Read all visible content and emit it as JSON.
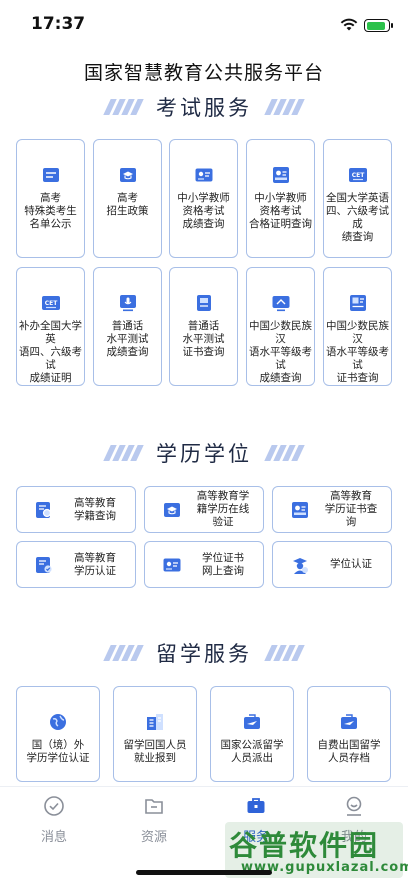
{
  "status": {
    "time": "17:37",
    "battery_level": 0.9
  },
  "page_title": "国家智慧教育公共服务平台",
  "sections": {
    "exam": {
      "title": "考试服务"
    },
    "degree": {
      "title": "学历学位"
    },
    "abroad": {
      "title": "留学服务"
    }
  },
  "exam_cards": [
    {
      "label": "高考\n特殊类考生\n名单公示",
      "icon": "list-icon"
    },
    {
      "label": "高考\n招生政策",
      "icon": "mortarboard-icon"
    },
    {
      "label": "中小学教师\n资格考试\n成绩查询",
      "icon": "id-card-icon"
    },
    {
      "label": "中小学教师\n资格考试\n合格证明查询",
      "icon": "certificate-icon"
    },
    {
      "label": "全国大学英语\n四、六级考试成\n绩查询",
      "icon": "cet-icon",
      "badge": "CET"
    },
    {
      "label": "补办全国大学英\n语四、六级考试\n成绩证明",
      "icon": "cet-icon",
      "badge": "CET"
    },
    {
      "label": "普通话\n水平测试\n成绩查询",
      "icon": "microphone-icon"
    },
    {
      "label": "普通话\n水平测试\n证书查询",
      "icon": "book-icon"
    },
    {
      "label": "中国少数民族汉\n语水平等级考试\n成绩查询",
      "icon": "monitor-icon"
    },
    {
      "label": "中国少数民族汉\n语水平等级考试\n证书查询",
      "icon": "image-card-icon"
    }
  ],
  "degree_cards": [
    {
      "label": "高等教育\n学籍查询",
      "icon": "search-doc-icon"
    },
    {
      "label": "高等教育学\n籍学历在线\n验证",
      "icon": "mortarboard-icon"
    },
    {
      "label": "高等教育\n学历证书查\n询",
      "icon": "certificate-icon"
    },
    {
      "label": "高等教育\n学历认证",
      "icon": "verify-doc-icon"
    },
    {
      "label": "学位证书\n网上查询",
      "icon": "id-card-icon"
    },
    {
      "label": "学位认证",
      "icon": "graduate-icon"
    }
  ],
  "abroad_cards": [
    {
      "label": "国（境）外\n学历学位认证",
      "icon": "globe-icon"
    },
    {
      "label": "留学回国人员\n就业报到",
      "icon": "building-icon"
    },
    {
      "label": "国家公派留学\n人员派出",
      "icon": "plane-card-icon"
    },
    {
      "label": "自费出国留学\n人员存档",
      "icon": "plane-card-icon"
    }
  ],
  "tabs": [
    {
      "label": "消息",
      "icon": "message-check-icon",
      "active": false
    },
    {
      "label": "资源",
      "icon": "folder-icon",
      "active": false
    },
    {
      "label": "服务",
      "icon": "briefcase-icon",
      "active": true
    },
    {
      "label": "我的",
      "icon": "user-icon",
      "active": false
    }
  ],
  "watermark": {
    "main": "谷普软件园",
    "sub": "www.gupuxlazal.com"
  },
  "colors": {
    "accent": "#2f63d8",
    "card_border": "#a8bfe8",
    "icon_blue": "#3b6fe0",
    "icon_light": "#cfe0ff"
  }
}
